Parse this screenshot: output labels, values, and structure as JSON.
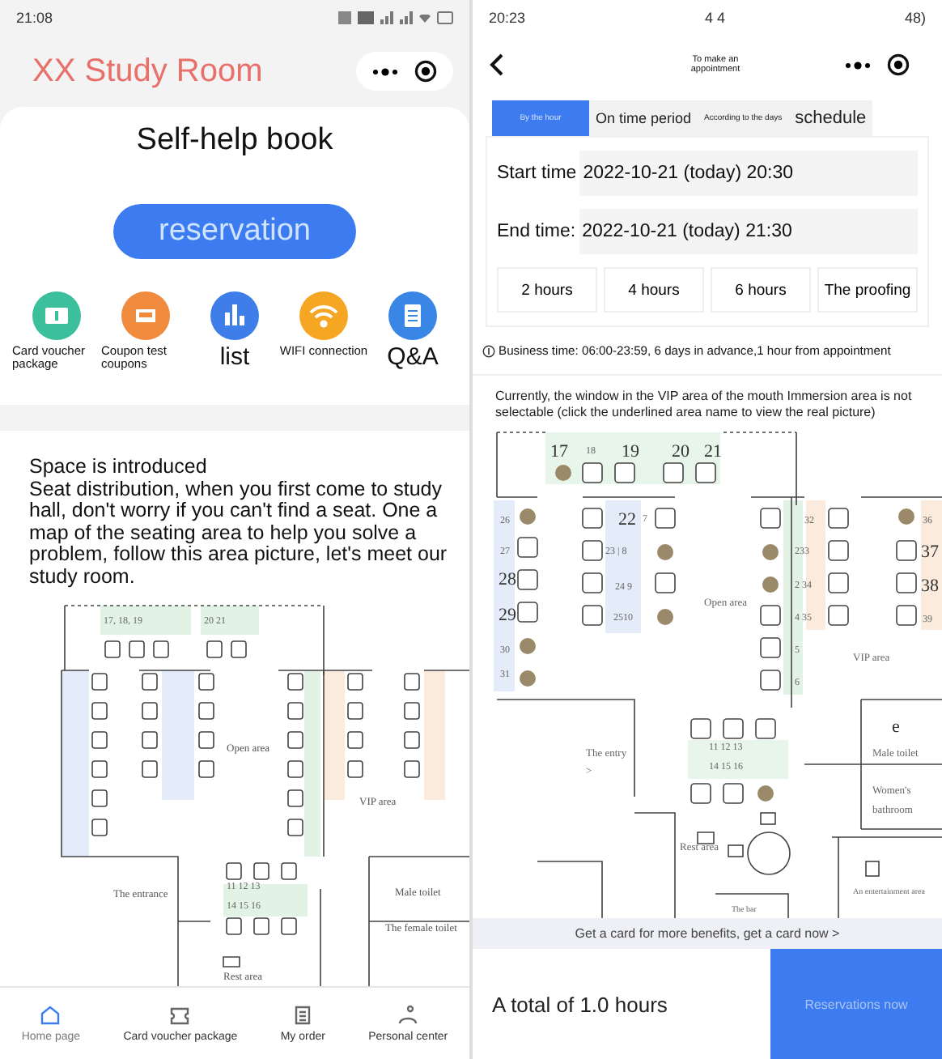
{
  "left": {
    "status_bar": {
      "time": "21:08"
    },
    "title": "XX Study Room",
    "heading": "Self-help book",
    "reserve_button": "reservation",
    "shortcuts": [
      {
        "label": "Card voucher package",
        "kind": "ticket",
        "color": "#3cbf9c"
      },
      {
        "label": "Coupon test coupons",
        "kind": "coupon",
        "color": "#f08a3c"
      },
      {
        "label": "list",
        "kind": "chart",
        "color": "#3f7ee8"
      },
      {
        "label": "WIFI connection",
        "kind": "wifi",
        "color": "#f5a623"
      },
      {
        "label": "Q&A",
        "kind": "doc",
        "color": "#3a86e6"
      }
    ],
    "intro_title": "Space is introduced",
    "intro_text": "Seat distribution, when you first come to study hall, don't worry if you can't find a seat. One a map of the seating area to help you solve a problem, follow this area picture, let's meet our study room.",
    "map_labels": [
      {
        "text": "17, 18, 19",
        "kind": "seat"
      },
      {
        "text": "20 21",
        "kind": "seat"
      },
      {
        "text": "Open area",
        "kind": "area"
      },
      {
        "text": "VIP area",
        "kind": "area"
      },
      {
        "text": "The entrance",
        "kind": "area"
      },
      {
        "text": "11 12 13",
        "kind": "seat"
      },
      {
        "text": "14 15 16",
        "kind": "seat"
      },
      {
        "text": "Male toilet",
        "kind": "area"
      },
      {
        "text": "The female toilet",
        "kind": "area"
      },
      {
        "text": "Rest area",
        "kind": "area"
      }
    ],
    "nav": [
      {
        "label": "Home page",
        "kind": "home",
        "selected": true
      },
      {
        "label": "Card voucher package",
        "kind": "ticket",
        "selected": false
      },
      {
        "label": "My order",
        "kind": "order",
        "selected": false
      },
      {
        "label": "Personal center",
        "kind": "person",
        "selected": false
      }
    ]
  },
  "right": {
    "status_bar": {
      "time": "20:23",
      "center": "4 4",
      "battery": "48)"
    },
    "title": "To make an appointment",
    "tabs": [
      {
        "label": "By the hour",
        "selected": true
      },
      {
        "label": "On time period",
        "selected": false
      },
      {
        "label": "According to the days",
        "selected": false
      },
      {
        "label": "schedule",
        "selected": false
      }
    ],
    "start_label": "Start time",
    "start_value": "2022-10-21 (today) 20:30",
    "end_label": "End time:",
    "end_value": "2022-10-21 (today) 21:30",
    "durations": [
      {
        "label": "2 hours",
        "selected": false
      },
      {
        "label": "4 hours",
        "selected": false
      },
      {
        "label": "6 hours",
        "selected": false
      },
      {
        "label": "The proofing",
        "selected": false
      }
    ],
    "business_note": "Business time: 06:00-23:59, 6 days in advance,1 hour from appointment",
    "map_note": "Currently, the window in the VIP area of the mouth Immersion area is not selectable (click the underlined area name to view the real picture)",
    "map_labels": [
      {
        "text": "17",
        "kind": "big"
      },
      {
        "text": "18",
        "kind": "seat"
      },
      {
        "text": "19",
        "kind": "big"
      },
      {
        "text": "20",
        "kind": "big"
      },
      {
        "text": "21",
        "kind": "big"
      },
      {
        "text": "26",
        "kind": "seat"
      },
      {
        "text": "27",
        "kind": "seat"
      },
      {
        "text": "28",
        "kind": "big"
      },
      {
        "text": "29",
        "kind": "big"
      },
      {
        "text": "30",
        "kind": "seat"
      },
      {
        "text": "31",
        "kind": "seat"
      },
      {
        "text": "22",
        "kind": "big"
      },
      {
        "text": "7",
        "kind": "seat"
      },
      {
        "text": "23 | 8",
        "kind": "seat"
      },
      {
        "text": "24  9",
        "kind": "seat"
      },
      {
        "text": "2510",
        "kind": "seat"
      },
      {
        "text": "Open area",
        "kind": "area"
      },
      {
        "text": "32",
        "kind": "seat"
      },
      {
        "text": "233",
        "kind": "seat"
      },
      {
        "text": "2 34",
        "kind": "seat"
      },
      {
        "text": "4 35",
        "kind": "seat"
      },
      {
        "text": "5",
        "kind": "seat"
      },
      {
        "text": "6",
        "kind": "seat"
      },
      {
        "text": "36",
        "kind": "seat"
      },
      {
        "text": "37",
        "kind": "big"
      },
      {
        "text": "38",
        "kind": "big"
      },
      {
        "text": "39",
        "kind": "seat"
      },
      {
        "text": "VIP area",
        "kind": "area"
      },
      {
        "text": "e",
        "kind": "big"
      },
      {
        "text": "Male toilet",
        "kind": "area"
      },
      {
        "text": "Women's",
        "kind": "area"
      },
      {
        "text": "bathroom",
        "kind": "area"
      },
      {
        "text": "The entry",
        "kind": "area"
      },
      {
        "text": ">",
        "kind": "area"
      },
      {
        "text": "11 12 13",
        "kind": "seat"
      },
      {
        "text": "14 15 16",
        "kind": "seat"
      },
      {
        "text": "Rest area",
        "kind": "area"
      },
      {
        "text": "An entertainment area",
        "kind": "small"
      },
      {
        "text": "The bar",
        "kind": "small"
      }
    ],
    "card_banner": "Get a card for more benefits, get a card now >",
    "total": "A total of 1.0 hours",
    "submit_button": "Reservations now"
  }
}
